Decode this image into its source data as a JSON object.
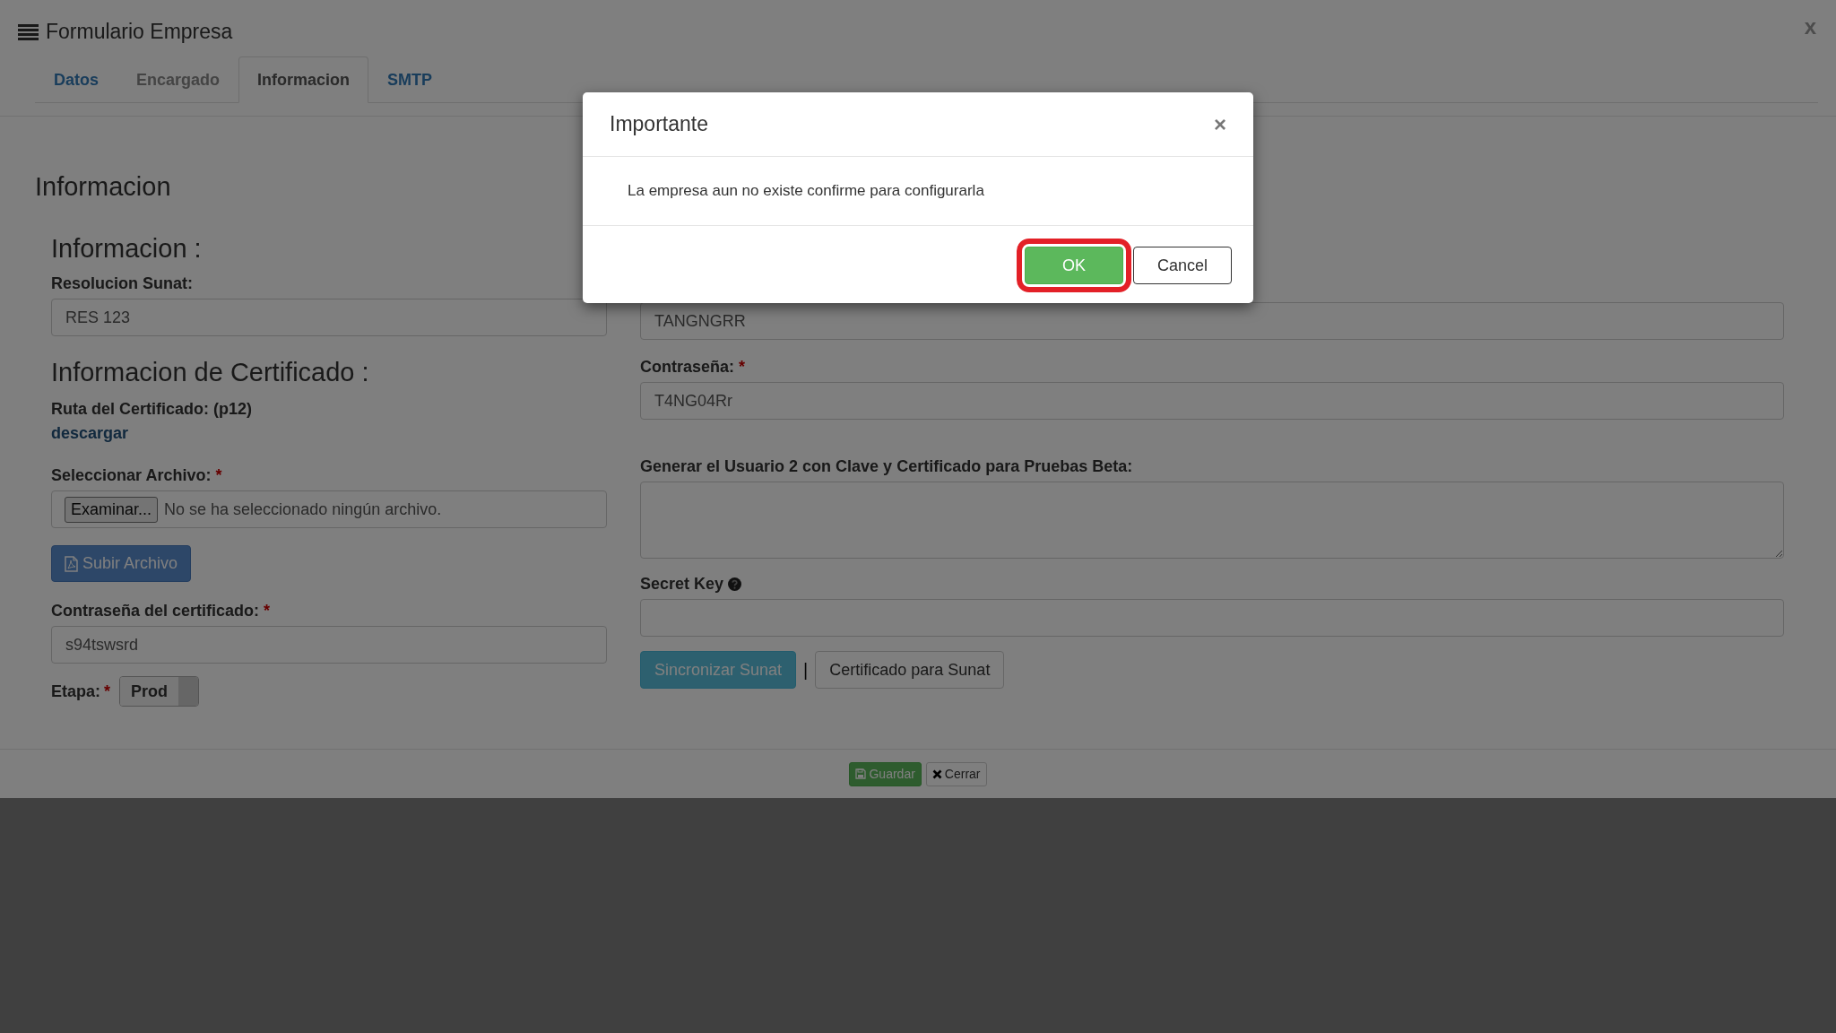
{
  "window": {
    "title": "Formulario Empresa",
    "close": "x"
  },
  "tabs": [
    {
      "label": "Datos",
      "selected": false,
      "disabled": false
    },
    {
      "label": "Encargado",
      "selected": false,
      "disabled": true
    },
    {
      "label": "Informacion",
      "selected": true,
      "disabled": false
    },
    {
      "label": "SMTP",
      "selected": false,
      "disabled": false
    }
  ],
  "section_title": "Informacion",
  "required_mark": "*",
  "left": {
    "heading": "Informacion :",
    "resolucion": {
      "label": "Resolucion Sunat:",
      "value": "RES 123"
    },
    "cert_heading": "Informacion de Certificado :",
    "ruta": {
      "label": "Ruta del Certificado: (p12)",
      "link": "descargar"
    },
    "archivo": {
      "label": "Seleccionar Archivo:",
      "required": true,
      "button": "Examinar...",
      "status": "No se ha seleccionado ningún archivo."
    },
    "upload_button": "Subir Archivo",
    "cert_password": {
      "label": "Contraseña del certificado:",
      "required": true,
      "value": "s94tswsrd"
    },
    "etapa": {
      "label": "Etapa:",
      "required": true,
      "value": "Prod",
      "on": true
    }
  },
  "right": {
    "usuario": {
      "value": "TANGNGRR"
    },
    "password": {
      "label": "Contraseña:",
      "required": true,
      "value": "T4NG04Rr"
    },
    "beta": {
      "label": "Generar el Usuario 2 con Clave y Certificado para Pruebas Beta:"
    },
    "secret_key": {
      "label": "Secret Key"
    },
    "buttons": [
      {
        "label": "Sincronizar Sunat",
        "kind": "info"
      },
      {
        "label": "Certificado para Sunat",
        "kind": "default"
      }
    ],
    "separator": "|"
  },
  "footer": [
    {
      "label": "Guardar",
      "kind": "save"
    },
    {
      "label": "Cerrar",
      "kind": "close"
    }
  ],
  "modal": {
    "title": "Importante",
    "close": "×",
    "message": "La empresa aun no existe confirme para configurarla",
    "buttons": [
      {
        "label": "OK",
        "kind": "primary",
        "highlighted": true
      },
      {
        "label": "Cancel",
        "kind": "default",
        "highlighted": false
      }
    ]
  }
}
